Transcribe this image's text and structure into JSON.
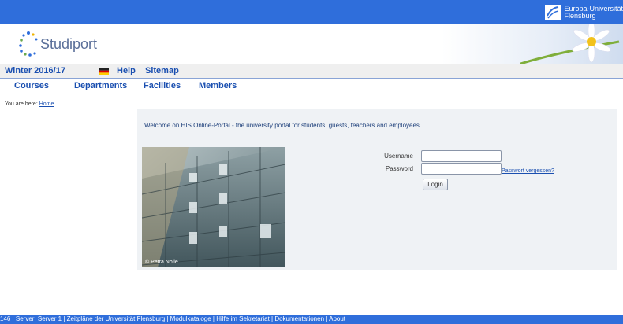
{
  "branding": {
    "university_line1": "Europa-Universität",
    "university_line2": "Flensburg",
    "portal_logo_text": "Studiport"
  },
  "nav_primary": {
    "semester": "Winter 2016/17",
    "help": "Help",
    "sitemap": "Sitemap"
  },
  "nav_secondary": {
    "courses": "Courses",
    "departments": "Departments",
    "facilities": "Facilities",
    "members": "Members"
  },
  "breadcrumb": {
    "prefix": "You are here:",
    "home": "Home"
  },
  "welcome": {
    "message": "Welcome on HIS Online-Portal - the university portal for students, guests, teachers and employees"
  },
  "photo": {
    "credit": "© Petra Nölle"
  },
  "login": {
    "username_label": "Username",
    "password_label": "Password",
    "username_value": "",
    "password_value": "",
    "forgot_link": "Passwort vergessen?",
    "button_label": "Login"
  },
  "footer": {
    "text": "146 | Server: Server 1 | Zeitpläne der Universität Flensburg | Modulkataloge | Hilfe im Sekretariat | Dokumentationen | About"
  },
  "colors": {
    "bar_blue": "#2f6edb",
    "link_blue": "#1a4fb0",
    "panel_bg": "#eff2f5"
  }
}
